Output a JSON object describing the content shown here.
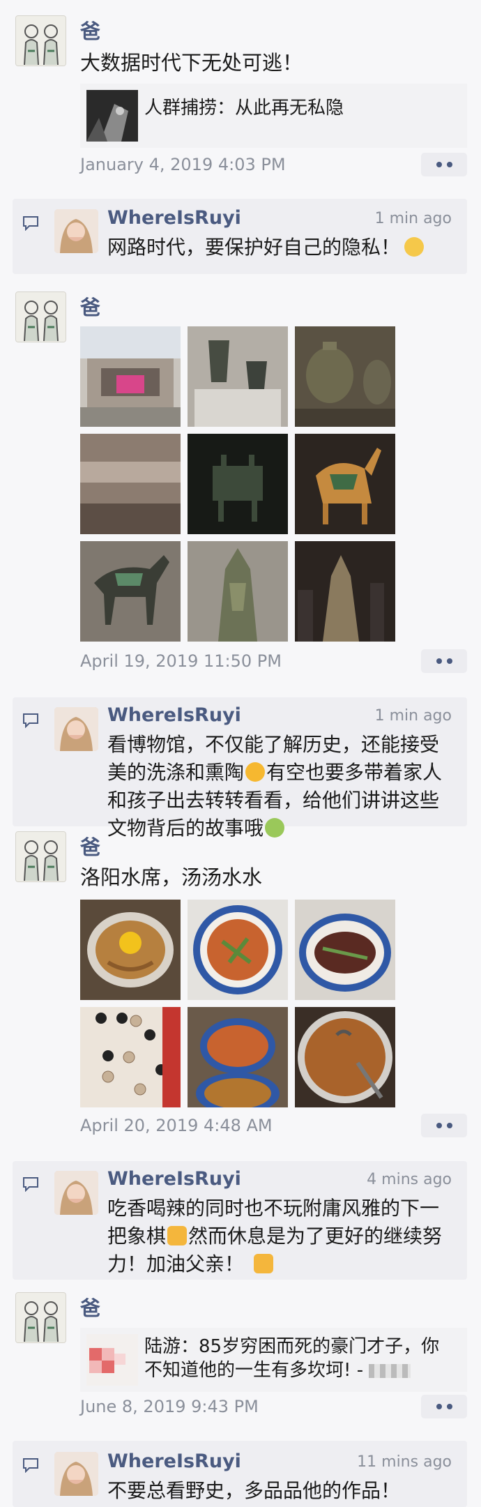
{
  "posts": [
    {
      "author": "爸",
      "text": "大数据时代下无处可逃！",
      "link_text": "人群捕捞：从此再无私隐",
      "time": "January 4, 2019 4:03 PM",
      "comment": {
        "name": "WhereIsRuyi",
        "ago": "1 min ago",
        "lines": [
          "网路时代，要保护好自己的隐私！"
        ],
        "emoji": "smile"
      }
    },
    {
      "author": "爸",
      "photos": [
        "museum-building",
        "bronze-vessels",
        "bronze-teapot",
        "display-case",
        "bronze-ding",
        "tricolor-camel",
        "bronze-horse",
        "ceramic-figure",
        "museum-statue"
      ],
      "time": "April 19, 2019 11:50 PM",
      "comment": {
        "name": "WhereIsRuyi",
        "ago": "1 min ago",
        "lines": [
          "看博物馆，不仅能了解历史，还能接受",
          "美的洗涤和熏陶",
          "有空也要多带着家人",
          "和孩子出去转转看看，给他们讲讲这些",
          "文物背后的故事哦"
        ],
        "emoji": "sun"
      }
    },
    {
      "author": "爸",
      "text": "洛阳水席，汤汤水水",
      "photos": [
        "soup-flower",
        "stew-bowl",
        "braised-meat",
        "chess-board",
        "soup-bowls",
        "thick-soup"
      ],
      "time": "April 20, 2019 4:48 AM",
      "comment": {
        "name": "WhereIsRuyi",
        "ago": "4 mins ago",
        "lines": [
          "吃香喝辣的同时也不玩附庸风雅的下一",
          "把象棋",
          "然而休息是为了更好的继续努",
          "力！加油父亲！"
        ],
        "emoji": "thumbs-up"
      }
    },
    {
      "author": "爸",
      "link_text_1": "陆游：85岁穷困而死的豪门才子，你",
      "link_text_2": "不知道他的一生有多坎坷! -",
      "time": "June 8, 2019 9:43 PM",
      "comment": {
        "name": "WhereIsRuyi",
        "ago": "11 mins ago",
        "lines": [
          "不要总看野史，多品品他的作品！"
        ]
      }
    }
  ],
  "colors": {
    "name": "#4a5a80",
    "time": "#8a8f9a",
    "background": "#f7f7f9",
    "comment_bg": "#eeeef2"
  },
  "icons": [
    "comment-bubble-icon",
    "more-dots-icon"
  ]
}
